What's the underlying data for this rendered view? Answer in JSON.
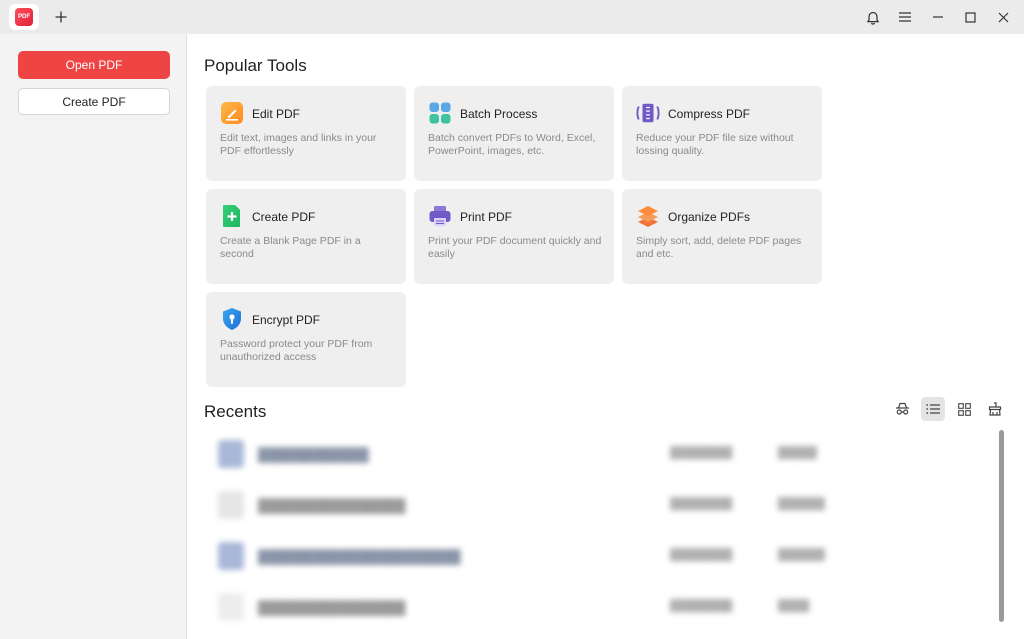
{
  "titlebar": {
    "app_icon": "pdf-app-logo",
    "logo_text": "PDF",
    "new_tab_icon": "plus-icon",
    "controls": [
      "bell-icon",
      "menu-icon",
      "minimize-icon",
      "maximize-icon",
      "close-icon"
    ]
  },
  "sidebar": {
    "open_label": "Open PDF",
    "create_label": "Create PDF",
    "accent": "#ee4444"
  },
  "popular": {
    "title": "Popular Tools",
    "tools": [
      {
        "name": "Edit PDF",
        "desc": "Edit text, images and links in your PDF effortlessly",
        "icon": "edit-pdf-icon"
      },
      {
        "name": "Batch Process",
        "desc": "Batch convert PDFs to Word, Excel, PowerPoint, images, etc.",
        "icon": "batch-process-icon"
      },
      {
        "name": "Compress PDF",
        "desc": "Reduce your PDF file size without lossing quality.",
        "icon": "compress-pdf-icon"
      },
      {
        "name": "Create PDF",
        "desc": "Create a Blank Page PDF in a second",
        "icon": "create-pdf-icon"
      },
      {
        "name": "Print PDF",
        "desc": "Print your PDF document quickly and easily",
        "icon": "printer-icon"
      },
      {
        "name": "Organize PDFs",
        "desc": "Simply sort, add, delete PDF pages and etc.",
        "icon": "layers-icon"
      },
      {
        "name": "Encrypt PDF",
        "desc": "Password protect your PDF from unauthorized access",
        "icon": "shield-lock-icon"
      }
    ]
  },
  "recents": {
    "title": "Recents",
    "view_icons": [
      "incognito-icon",
      "list-view-icon",
      "grid-view-icon",
      "clear-history-icon"
    ],
    "active_view": "list-view-icon"
  }
}
